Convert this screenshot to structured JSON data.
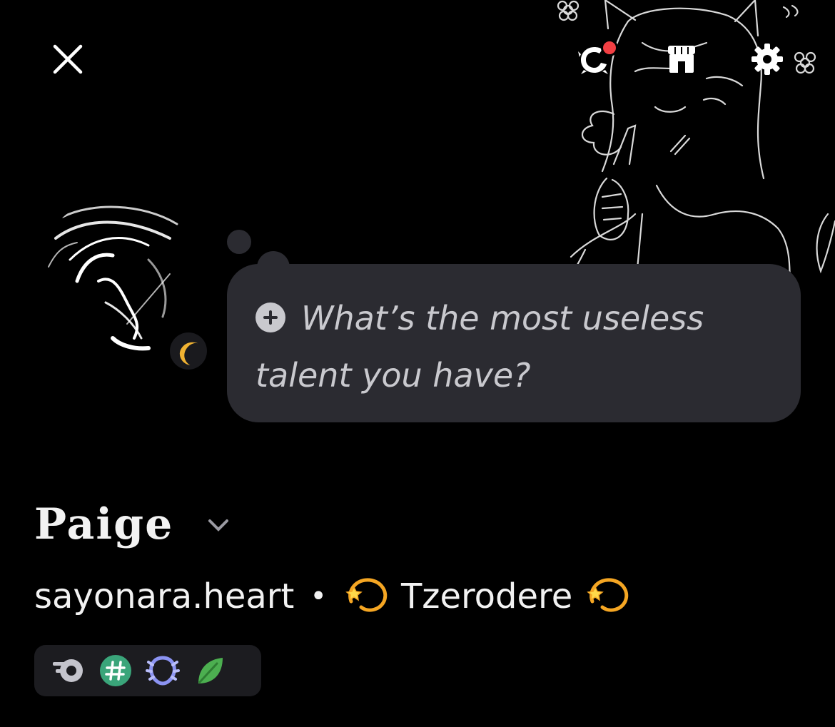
{
  "profile": {
    "display_name": "Paige",
    "username": "sayonara.heart",
    "separator": "•",
    "pronouns": "Tzerodere",
    "status": "idle"
  },
  "prompt": {
    "text": "What’s the most useless talent you have?"
  },
  "icons": {
    "close": "close-icon",
    "nitro": "nitro-icon",
    "shop": "shop-icon",
    "settings": "gear-icon",
    "plus": "plus-icon",
    "status": "moon-icon",
    "chevron": "chevron-down-icon",
    "emoji": "dizzy-emoji-icon"
  },
  "badges": [
    {
      "name": "hypesquad-badge"
    },
    {
      "name": "hashtag-badge"
    },
    {
      "name": "nitro-laurel-badge"
    },
    {
      "name": "leaf-badge"
    }
  ],
  "colors": {
    "background": "#000000",
    "bubble": "#2b2b31",
    "notification": "#f23f43",
    "idle": "#f0b232",
    "badge_bg": "#1c1c20"
  }
}
